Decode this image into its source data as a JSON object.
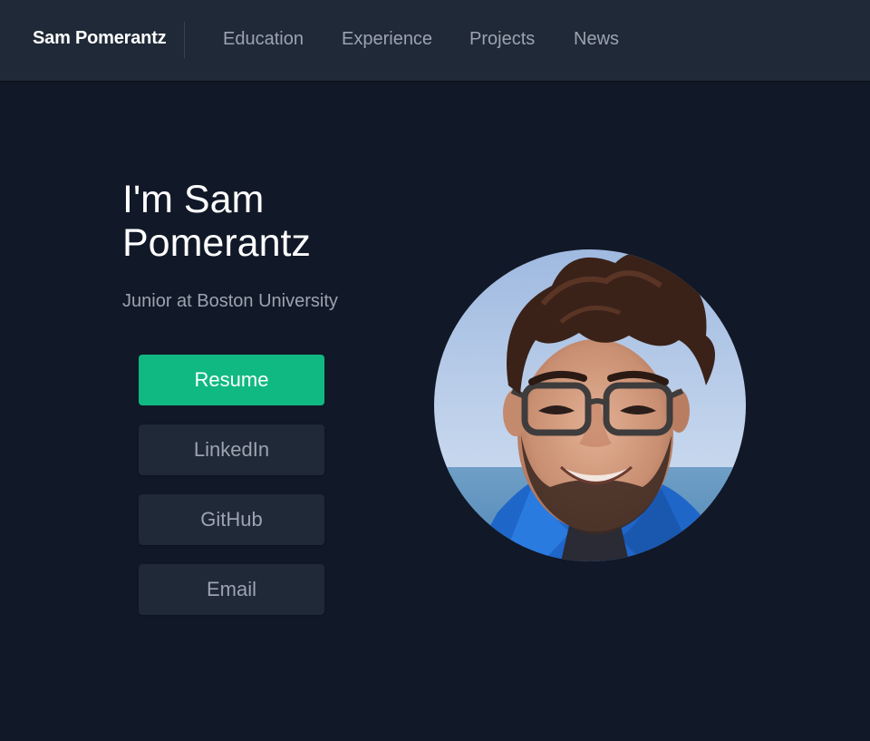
{
  "navbar": {
    "brand": "Sam Pomerantz",
    "links": [
      {
        "label": "Education"
      },
      {
        "label": "Experience"
      },
      {
        "label": "Projects"
      },
      {
        "label": "News"
      }
    ]
  },
  "hero": {
    "heading": "I'm Sam Pomerantz",
    "subtitle": "Junior at Boston University",
    "buttons": {
      "resume": "Resume",
      "linkedin": "LinkedIn",
      "github": "GitHub",
      "email": "Email"
    }
  },
  "colors": {
    "background": "#111827",
    "navbar": "#1f2937",
    "accent": "#10b981",
    "secondary_button": "#1f2937",
    "muted_text": "#9ca3af"
  }
}
